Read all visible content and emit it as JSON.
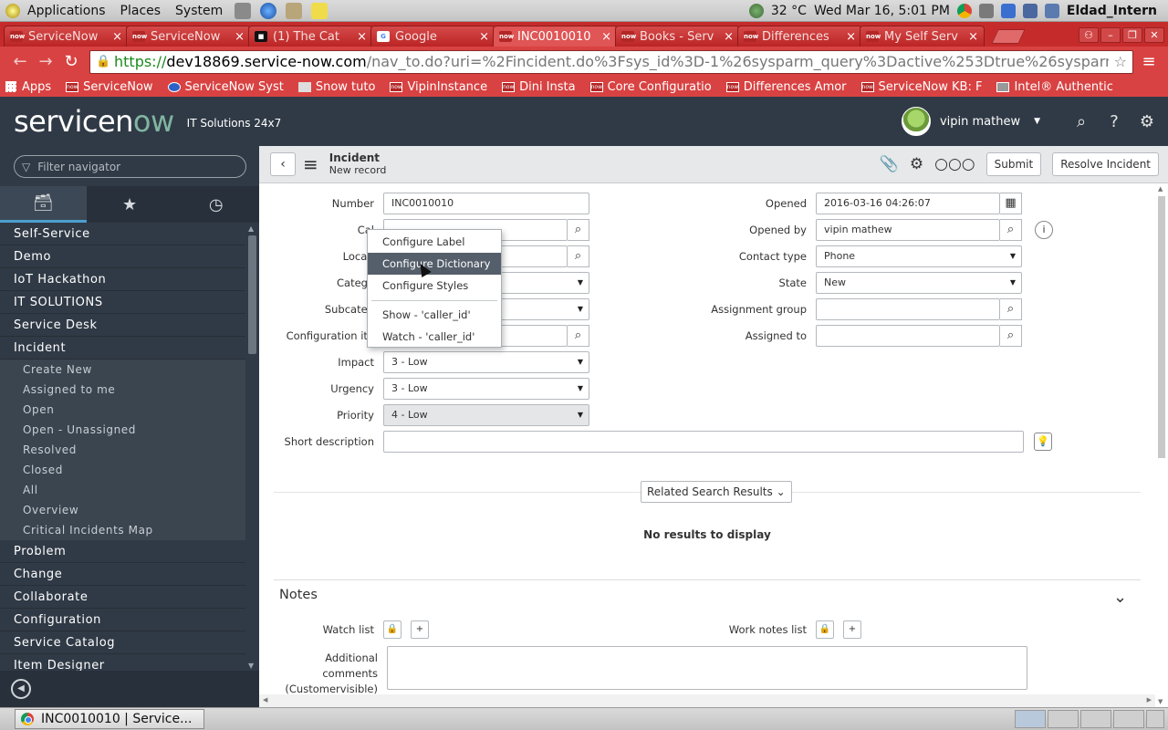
{
  "top_panel": {
    "menus": [
      "Applications",
      "Places",
      "System"
    ],
    "weather": "32 °C",
    "datetime": "Wed Mar 16,  5:01 PM",
    "user": "Eldad_Intern"
  },
  "browser": {
    "tabs": [
      {
        "label": "ServiceNow",
        "active": false
      },
      {
        "label": "ServiceNow ",
        "active": false
      },
      {
        "label": "(1)  The Cat",
        "active": false
      },
      {
        "label": "Google",
        "active": false
      },
      {
        "label": "INC0010010",
        "active": true
      },
      {
        "label": "Books - Serv",
        "active": false
      },
      {
        "label": "Differences ",
        "active": false
      },
      {
        "label": "My Self Serv",
        "active": false
      }
    ],
    "url": {
      "protocol": "https://",
      "host": "dev18869.service-now.com",
      "path": "/nav_to.do?uri=%2Fincident.do%3Fsys_id%3D-1%26sysparm_query%3Dactive%253Dtrue%26sysparm"
    },
    "bookmarks": [
      "Apps",
      "ServiceNow",
      "ServiceNow Syst",
      "Snow tuto",
      "VipinInstance",
      "Dini Insta",
      "Core Configuratio",
      "Differences Amor",
      "ServiceNow KB: F",
      "Intel® Authentic"
    ]
  },
  "sn_header": {
    "logo_text_a": "servicen",
    "logo_text_b": "ow",
    "tagline": "IT Solutions 24x7",
    "user_name": "vipin mathew"
  },
  "nav": {
    "filter_placeholder": "Filter navigator",
    "items": [
      {
        "label": "Self-Service"
      },
      {
        "label": "Demo"
      },
      {
        "label": "IoT Hackathon"
      },
      {
        "label": "IT SOLUTIONS"
      },
      {
        "label": "Service Desk"
      },
      {
        "label": "Incident"
      }
    ],
    "incident_sub": [
      "Create New",
      "Assigned to me",
      "Open",
      "Open - Unassigned",
      "Resolved",
      "Closed",
      "All",
      "Overview",
      "Critical Incidents Map"
    ],
    "items_after": [
      {
        "label": "Problem"
      },
      {
        "label": "Change"
      },
      {
        "label": "Collaborate"
      },
      {
        "label": "Configuration"
      },
      {
        "label": "Service Catalog"
      },
      {
        "label": "Item Designer"
      }
    ]
  },
  "form": {
    "header": {
      "title": "Incident",
      "subtitle": "New record",
      "submit": "Submit",
      "resolve": "Resolve Incident"
    },
    "labels": {
      "number": "Number",
      "caller": "Cal",
      "location": "Locati",
      "category": "Catego",
      "subcategory": "Subcateg",
      "ci": "Configuration ite",
      "impact": "Impact",
      "urgency": "Urgency",
      "priority": "Priority",
      "short_desc": "Short description",
      "opened": "Opened",
      "opened_by": "Opened by",
      "contact_type": "Contact type",
      "state": "State",
      "assignment_group": "Assignment group",
      "assigned_to": "Assigned to"
    },
    "values": {
      "number": "INC0010010",
      "impact": "3 - Low",
      "urgency": "3 - Low",
      "priority": "4 - Low",
      "opened": "2016-03-16 04:26:07",
      "opened_by": "vipin mathew",
      "contact_type": "Phone",
      "state": "New"
    },
    "related_button": "Related Search Results",
    "no_results": "No results to display",
    "notes": {
      "title": "Notes",
      "watch_list": "Watch list",
      "work_notes_list": "Work notes list",
      "additional_comments_l1": "Additional",
      "additional_comments_l2": "comments",
      "additional_comments_l3": "(Customervisible)"
    }
  },
  "context_menu": {
    "items": [
      "Configure Label",
      "Configure Dictionary",
      "Configure Styles",
      "Show - 'caller_id'",
      "Watch - 'caller_id'"
    ],
    "hover_index": 1
  },
  "taskbar": {
    "window_label": "INC0010010 | Service..."
  },
  "colors": {
    "sn_dark": "#303a46",
    "chrome_red": "#d94242",
    "menu_hover": "#555f6b"
  }
}
